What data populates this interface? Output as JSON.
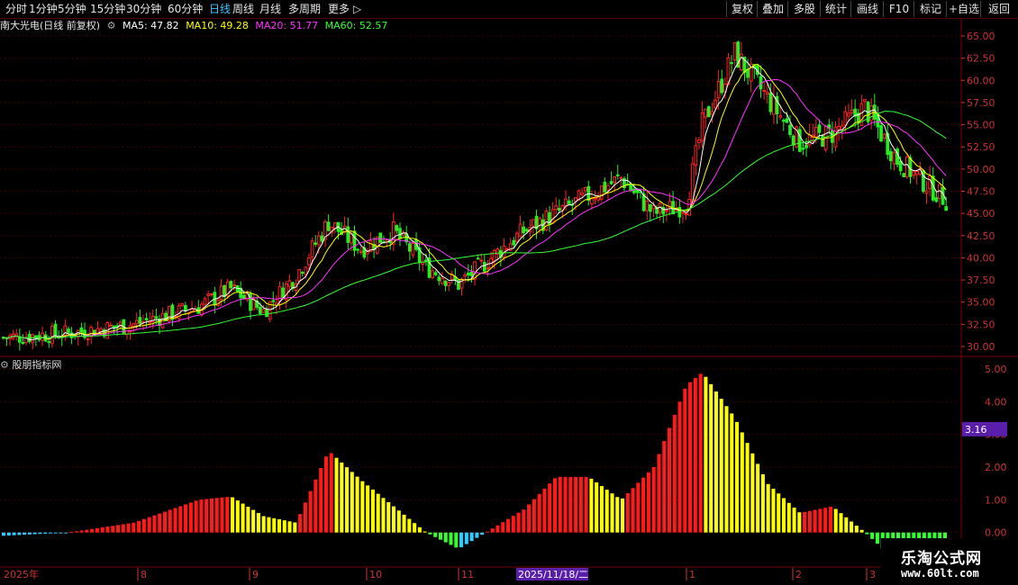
{
  "toolbar": {
    "tabs": [
      "分时",
      "1分钟",
      "5分钟",
      "15分钟",
      "30分钟",
      "60分钟",
      "日线",
      "周线",
      "月线",
      "多周期",
      "更多"
    ],
    "active_tab": "日线",
    "right_buttons": [
      "复权",
      "叠加",
      "多股",
      "统计",
      "画线",
      "F10",
      "标记",
      "+自选",
      "返回"
    ]
  },
  "info": {
    "title": "南大光电(日线 前复权)",
    "ma5": "MA5: 47.82",
    "ma10": "MA10: 49.28",
    "ma20": "MA20: 51.77",
    "ma60": "MA60: 52.57",
    "colors": {
      "ma5": "#ffffff",
      "ma10": "#ffff00",
      "ma20": "#ff33ff",
      "ma60": "#33ff33"
    }
  },
  "indicator": {
    "title": "股朋指标网",
    "current_value": "3.16"
  },
  "price_axis": {
    "ticks": [
      "65.00",
      "62.50",
      "60.00",
      "57.50",
      "55.00",
      "52.50",
      "50.00",
      "47.50",
      "45.00",
      "42.50",
      "40.00",
      "37.50",
      "35.00",
      "32.50",
      "30.00"
    ],
    "min": 30,
    "max": 65
  },
  "ind_axis": {
    "ticks": [
      "5.00",
      "4.00",
      "3.00",
      "2.00",
      "1.00",
      "0.00"
    ],
    "min": -1,
    "max": 5
  },
  "date_axis": {
    "labels": [
      "2025年",
      "8",
      "9",
      "10",
      "11",
      "2025/11/18/二",
      "1",
      "2",
      "3"
    ],
    "highlight": "2025/11/18/二"
  },
  "logo": {
    "line1": "乐淘公式网",
    "line2": "www.60lt.com"
  },
  "chart_data": {
    "type": "candlestick",
    "series": [
      {
        "name": "MA5",
        "values": []
      },
      {
        "name": "MA10",
        "values": []
      },
      {
        "name": "MA20",
        "values": []
      },
      {
        "name": "MA60",
        "values": []
      }
    ],
    "price_keypoints": [
      [
        0,
        31.0
      ],
      [
        20,
        31.5
      ],
      [
        40,
        32.5
      ],
      [
        60,
        34.5
      ],
      [
        70,
        36.5
      ],
      [
        80,
        34.0
      ],
      [
        90,
        38.0
      ],
      [
        100,
        44.0
      ],
      [
        110,
        41.0
      ],
      [
        120,
        43.0
      ],
      [
        130,
        39.0
      ],
      [
        140,
        37.0
      ],
      [
        150,
        40.0
      ],
      [
        160,
        43.0
      ],
      [
        170,
        45.0
      ],
      [
        180,
        47.0
      ],
      [
        190,
        49.0
      ],
      [
        200,
        45.0
      ],
      [
        210,
        46.0
      ],
      [
        215,
        55.0
      ],
      [
        225,
        63.0
      ],
      [
        235,
        58.0
      ],
      [
        245,
        53.0
      ],
      [
        255,
        54.0
      ],
      [
        265,
        57.0
      ],
      [
        275,
        51.0
      ],
      [
        285,
        48.0
      ],
      [
        290,
        46.5
      ]
    ],
    "indicator_keypoints": [
      [
        0,
        -0.1
      ],
      [
        20,
        0.0
      ],
      [
        40,
        0.3
      ],
      [
        60,
        1.0
      ],
      [
        70,
        1.1
      ],
      [
        80,
        0.5
      ],
      [
        90,
        0.3
      ],
      [
        100,
        2.5
      ],
      [
        110,
        1.6
      ],
      [
        120,
        0.8
      ],
      [
        130,
        0.0
      ],
      [
        140,
        -0.5
      ],
      [
        150,
        0.1
      ],
      [
        160,
        0.7
      ],
      [
        170,
        1.7
      ],
      [
        180,
        1.7
      ],
      [
        190,
        1.0
      ],
      [
        200,
        2.0
      ],
      [
        210,
        4.5
      ],
      [
        215,
        4.9
      ],
      [
        225,
        3.5
      ],
      [
        235,
        1.5
      ],
      [
        245,
        0.6
      ],
      [
        255,
        0.8
      ],
      [
        265,
        0.0
      ],
      [
        275,
        -0.9
      ],
      [
        290,
        -1.0
      ]
    ],
    "ylim": [
      30,
      65
    ]
  }
}
